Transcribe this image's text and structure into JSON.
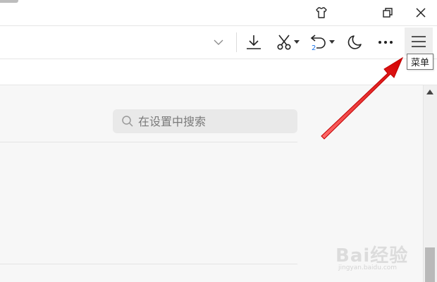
{
  "titlebar": {
    "buttons": [
      {
        "name": "skin-icon"
      },
      {
        "name": "restore-icon"
      },
      {
        "name": "close-icon"
      }
    ]
  },
  "toolbar": {
    "items": [
      {
        "name": "dropdown-chevron-icon"
      },
      {
        "name": "download-icon"
      },
      {
        "name": "screenshot-scissors-icon"
      },
      {
        "name": "undo-close-tab-icon"
      },
      {
        "name": "night-mode-moon-icon"
      },
      {
        "name": "more-dots-icon"
      },
      {
        "name": "menu-hamburger-icon"
      }
    ],
    "undo_badge": "2"
  },
  "tooltip": {
    "text": "菜单"
  },
  "settings": {
    "search_placeholder": "在设置中搜索"
  },
  "watermark": {
    "brand": "Bai经验",
    "url": "jingyan.baidu.com"
  },
  "colors": {
    "accent_blue": "#1a73e8",
    "arrow_red": "#e51b1b"
  }
}
